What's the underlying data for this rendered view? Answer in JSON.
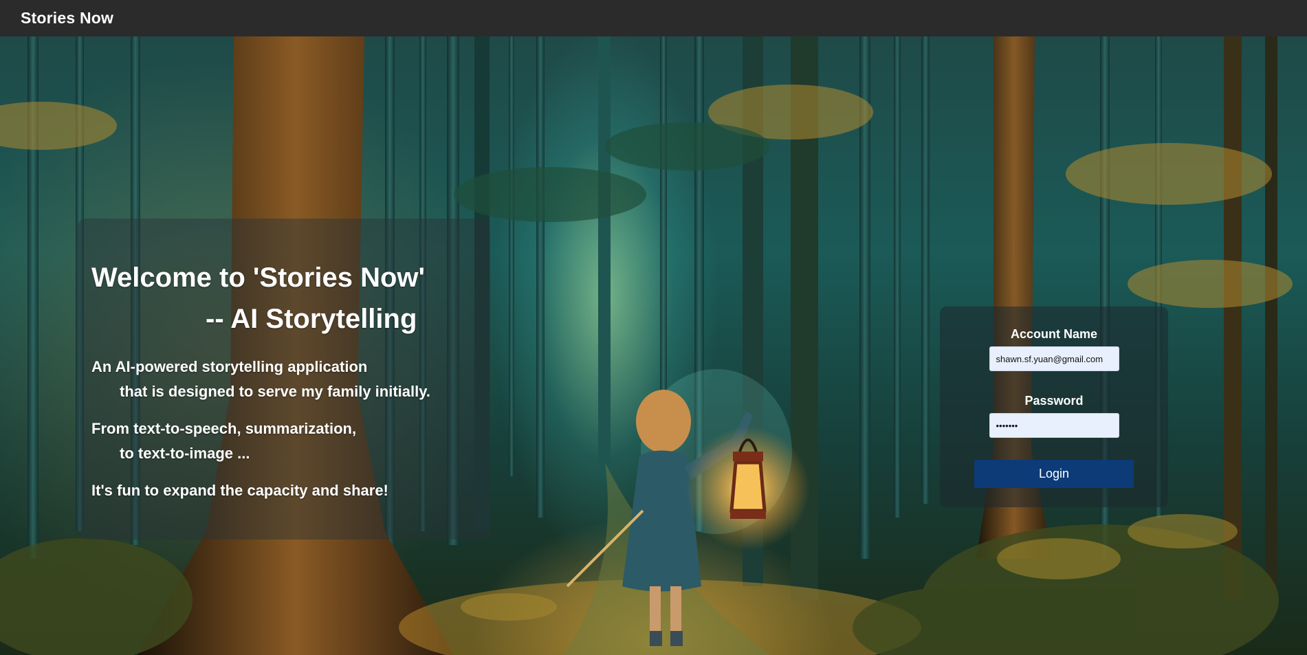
{
  "app": {
    "title": "Stories Now"
  },
  "intro": {
    "title_line1": "Welcome to 'Stories Now'",
    "title_line2": "-- AI Storytelling",
    "para1_line1": "An AI-powered storytelling application",
    "para1_line2": "that is designed to serve my family initially.",
    "para2_line1": "From text-to-speech, summarization,",
    "para2_line2": "to text-to-image ...",
    "para3": "It's fun to expand the capacity and share!"
  },
  "login": {
    "account_label": "Account Name",
    "account_value": "shawn.sf.yuan@gmail.com",
    "password_label": "Password",
    "password_value": "•••••••",
    "button_label": "Login"
  },
  "colors": {
    "topbar_bg": "#2b2b2b",
    "login_button": "#0d3b78",
    "input_bg": "#e8f0fe"
  }
}
